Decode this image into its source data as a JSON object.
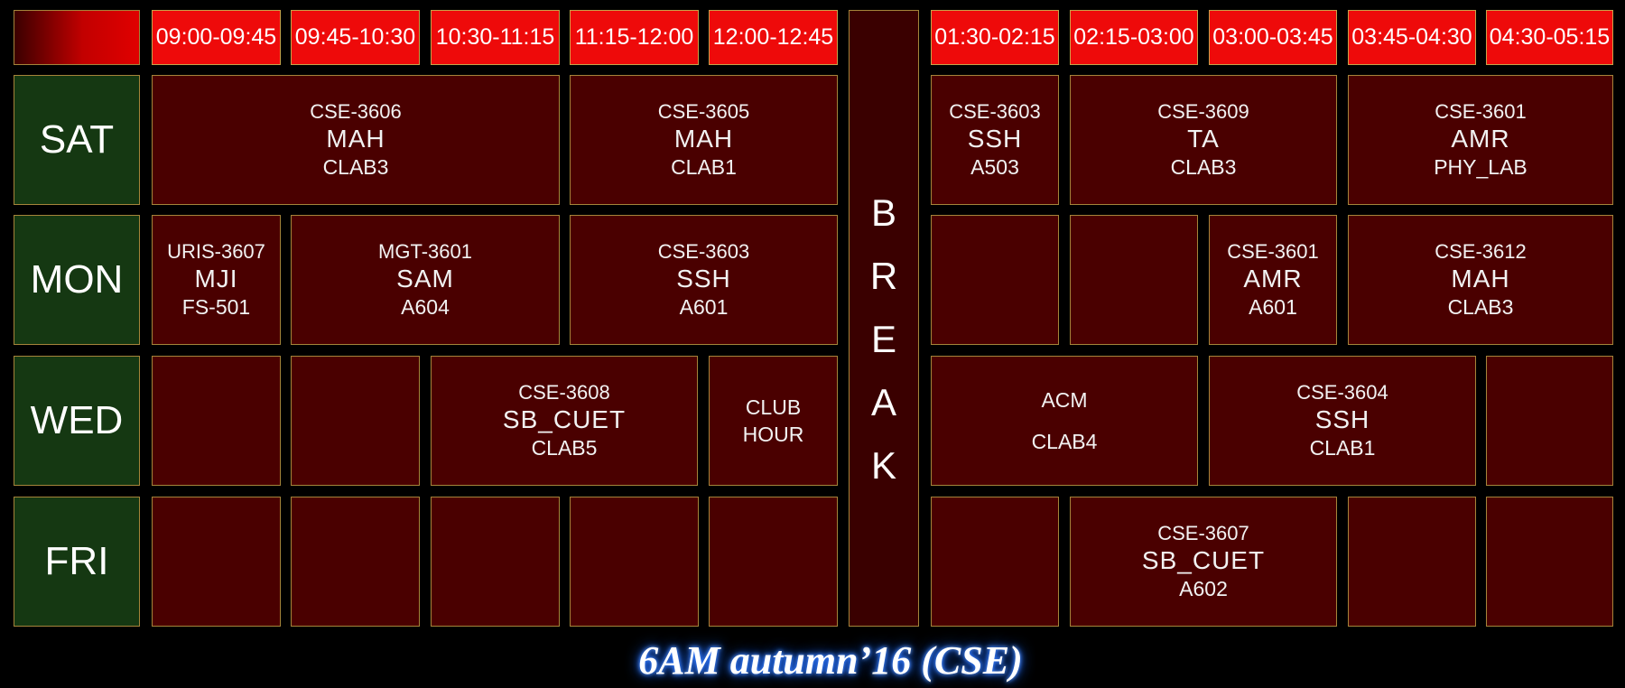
{
  "times": [
    "09:00-09:45",
    "09:45-10:30",
    "10:30-11:15",
    "11:15-12:00",
    "12:00-12:45",
    "01:30-02:15",
    "02:15-03:00",
    "03:00-03:45",
    "03:45-04:30",
    "04:30-05:15"
  ],
  "days": [
    "SAT",
    "MON",
    "WED",
    "FRI"
  ],
  "break_letters": [
    "B",
    "R",
    "E",
    "A",
    "K"
  ],
  "sat": [
    {
      "code": "CSE-3606",
      "inst": "MAH",
      "room": "CLAB3"
    },
    {
      "code": "CSE-3605",
      "inst": "MAH",
      "room": "CLAB1"
    },
    {
      "code": "CSE-3603",
      "inst": "SSH",
      "room": "A503"
    },
    {
      "code": "CSE-3609",
      "inst": "TA",
      "room": "CLAB3"
    },
    {
      "code": "CSE-3601",
      "inst": "AMR",
      "room": "PHY_LAB"
    }
  ],
  "mon": [
    {
      "code": "URIS-3607",
      "inst": "MJI",
      "room": "FS-501"
    },
    {
      "code": "MGT-3601",
      "inst": "SAM",
      "room": "A604"
    },
    {
      "code": "CSE-3603",
      "inst": "SSH",
      "room": "A601"
    },
    {
      "code": "CSE-3601",
      "inst": "AMR",
      "room": "A601"
    },
    {
      "code": "CSE-3612",
      "inst": "MAH",
      "room": "CLAB3"
    }
  ],
  "wed": {
    "cse3608": {
      "code": "CSE-3608",
      "inst": "SB_CUET",
      "room": "CLAB5"
    },
    "club": {
      "line1": "CLUB",
      "line2": "HOUR"
    },
    "acm": {
      "line1": "ACM",
      "line2": "CLAB4"
    },
    "cse3604": {
      "code": "CSE-3604",
      "inst": "SSH",
      "room": "CLAB1"
    }
  },
  "fri": {
    "cse3607": {
      "code": "CSE-3607",
      "inst": "SB_CUET",
      "room": "A602"
    }
  },
  "footer": "6AM autumn’16 (CSE)",
  "colors": {
    "time_header": "#ee0a0a",
    "day_cell": "#153812",
    "class_cell": "#4a0000",
    "border": "#a5843a"
  }
}
